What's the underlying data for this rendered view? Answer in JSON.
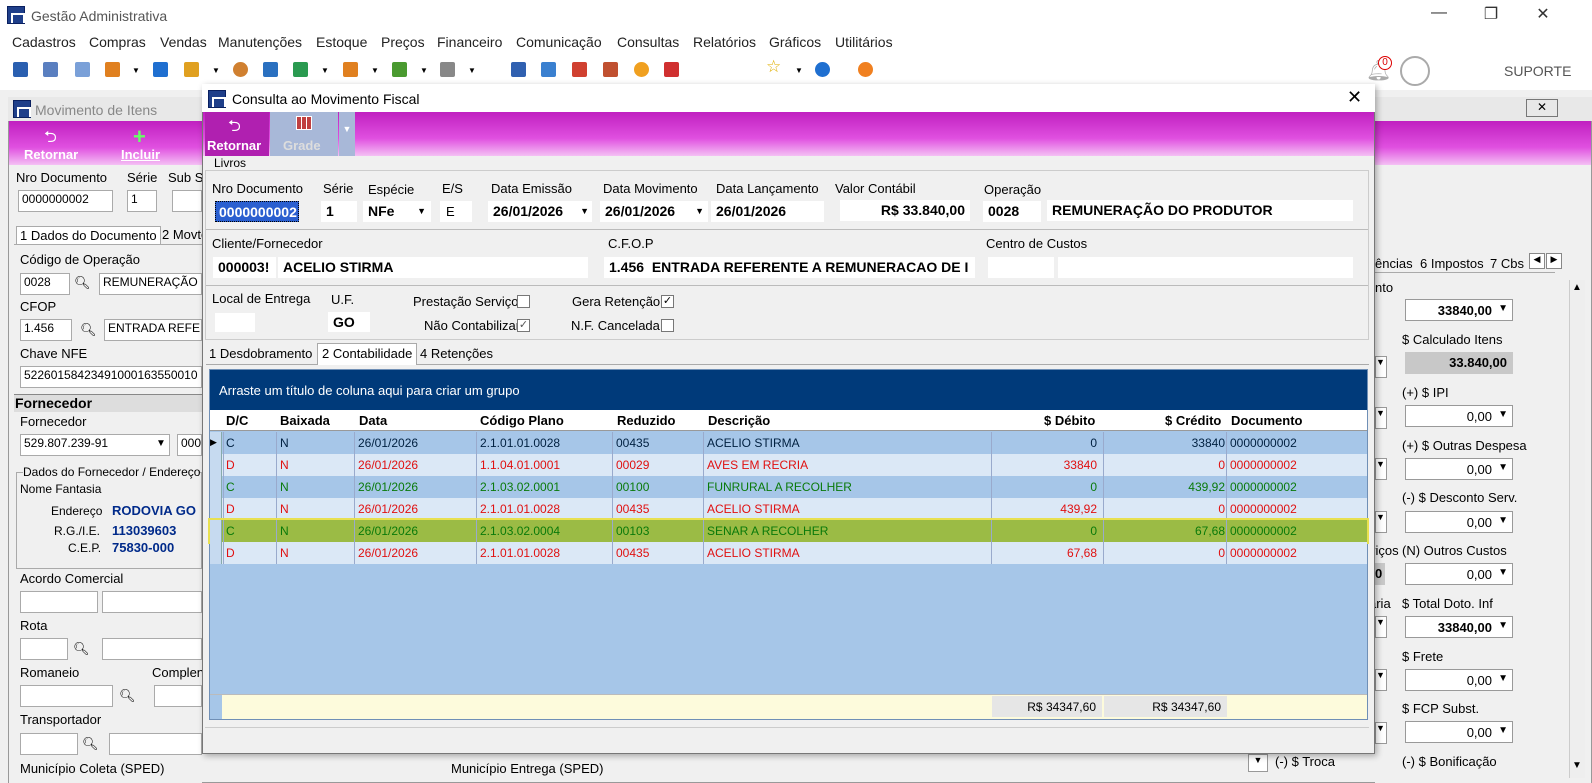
{
  "app": {
    "title": "Gestão Administrativa",
    "window_controls": {
      "minimize": "—",
      "restore": "❐",
      "close": "✕"
    }
  },
  "menu": [
    "Cadastros",
    "Compras",
    "Vendas",
    "Manutenções",
    "Estoque",
    "Preços",
    "Financeiro",
    "Comunicação",
    "Consultas",
    "Relatórios",
    "Gráficos",
    "Utilitários"
  ],
  "toolbar": {
    "notification_count": "0",
    "user_label": "SUPORTE"
  },
  "back_window": {
    "title": "Movimento de Itens",
    "actions": {
      "return": "Retornar",
      "include": "Incluir"
    },
    "labels": {
      "nro_documento": "Nro Documento",
      "serie": "Série",
      "sub_serie": "Sub S",
      "codigo_operacao": "Código de Operação",
      "cfop": "CFOP",
      "chave_nfe": "Chave NFE",
      "fornecedor_header": "Fornecedor",
      "fornecedor": "Fornecedor",
      "dados_fornecedor": "Dados do Fornecedor / Endereço",
      "nome_fantasia": "Nome Fantasia",
      "endereco": "Endereço",
      "rg_ie": "R.G./I.E.",
      "cep": "C.E.P.",
      "acordo_comercial": "Acordo Comercial",
      "rota": "Rota",
      "romaneio": "Romaneio",
      "complemento": "Complen",
      "transportador": "Transportador",
      "municipio_coleta": "Município Coleta (SPED)",
      "municipio_entrega": "Município Entrega (SPED)"
    },
    "values": {
      "nro_documento": "0000000002",
      "serie": "1",
      "codigo_operacao": "0028",
      "operacao_desc": "REMUNERAÇÃO",
      "cfop": "1.456",
      "cfop_desc": "ENTRADA REFE",
      "chave_nfe": "52260158423491000163550010",
      "fornecedor_doc": "529.807.239-91",
      "fornecedor_cod": "000",
      "endereco": "RODOVIA GO",
      "rg_ie": "113039603",
      "cep": "75830-000"
    },
    "tabs": [
      "1 Dados do Documento",
      "2 Movto"
    ],
    "right_tabs": [
      "ências",
      "6 Impostos",
      "7 Cbs"
    ],
    "right_panel": {
      "header": "nto",
      "total_top": "33840,00",
      "calc_itens_label": "$ Calculado Itens",
      "calc_itens_value": "33.840,00",
      "ipi_label": "(+) $ IPI",
      "ipi_value": "0,00",
      "outras_despesas_label": "(+) $ Outras Despesa",
      "outras_despesas_value": "0,00",
      "desconto_serv_label": "(-) $ Desconto Serv.",
      "desconto_serv_value": "0,00",
      "servicos_label": "viços",
      "outros_custos_label": "(N) Outros Custos",
      "outros_custos_value": "0,00",
      "servicos_value": "0",
      "total_doto_label": "$ Total Doto. Inf",
      "total_doto_value": "33840,00",
      "ria_label": "ária",
      "frete_label": "$ Frete",
      "frete_value": "0,00",
      "fcp_label": "$ FCP Subst.",
      "fcp_value": "0,00",
      "troca_label": "(-) $ Troca",
      "bonificacao_label": "(-) $ Bonificação"
    }
  },
  "dialog": {
    "title": "Consulta ao Movimento Fiscal",
    "actions": {
      "return": "Retornar",
      "grid": "Grade"
    },
    "section": "Livros",
    "labels": {
      "nro_documento": "Nro Documento",
      "serie": "Série",
      "especie": "Espécie",
      "es": "E/S",
      "data_emissao": "Data Emissão",
      "data_movimento": "Data Movimento",
      "data_lancamento": "Data Lançamento",
      "valor_contabil": "Valor Contábil",
      "operacao": "Operação",
      "cliente_fornecedor": "Cliente/Fornecedor",
      "cfop": "C.F.O.P",
      "centro_custos": "Centro de Custos",
      "local_entrega": "Local de Entrega",
      "uf": "U.F.",
      "prestacao_servico": "Prestação Serviço",
      "gera_retencao": "Gera Retenção",
      "nao_contabilizar": "Não Contabilizar",
      "nf_cancelada": "N.F. Cancelada"
    },
    "values": {
      "nro_documento": "0000000002",
      "serie": "1",
      "especie": "NFe",
      "es": "E",
      "data_emissao": "26/01/2026",
      "data_movimento": "26/01/2026",
      "data_lancamento": "26/01/2026",
      "valor_contabil": "R$ 33.840,00",
      "operacao_cod": "0028",
      "operacao_desc": "REMUNERAÇÃO DO PRODUTOR",
      "cliente_cod": "000003!",
      "cliente_nome": "ACELIO STIRMA",
      "cfop": "1.456",
      "cfop_desc": "ENTRADA REFERENTE A REMUNERACAO DE I",
      "uf": "GO"
    },
    "checks": {
      "prestacao_servico": false,
      "gera_retencao": true,
      "nao_contabilizar": true,
      "nf_cancelada": false
    },
    "tabs": [
      "1 Desdobramento",
      "2 Contabilidade",
      "4 Retenções"
    ],
    "active_tab": "2 Contabilidade",
    "grid": {
      "group_hint": "Arraste um título de coluna aqui para criar um grupo",
      "columns": [
        "D/C",
        "Baixada",
        "Data",
        "Código Plano",
        "Reduzido",
        "Descrição",
        "$ Débito",
        "$ Crédito",
        "Documento"
      ],
      "rows": [
        {
          "dc": "C",
          "baixada": "N",
          "data": "26/01/2026",
          "codigo": "2.1.01.01.0028",
          "reduzido": "00435",
          "descricao": "ACELIO STIRMA",
          "debito": "0",
          "credito": "33840",
          "documento": "0000000002"
        },
        {
          "dc": "D",
          "baixada": "N",
          "data": "26/01/2026",
          "codigo": "1.1.04.01.0001",
          "reduzido": "00029",
          "descricao": "AVES EM RECRIA",
          "debito": "33840",
          "credito": "0",
          "documento": "0000000002"
        },
        {
          "dc": "C",
          "baixada": "N",
          "data": "26/01/2026",
          "codigo": "2.1.03.02.0001",
          "reduzido": "00100",
          "descricao": "FUNRURAL A RECOLHER",
          "debito": "0",
          "credito": "439,92",
          "documento": "0000000002"
        },
        {
          "dc": "D",
          "baixada": "N",
          "data": "26/01/2026",
          "codigo": "2.1.01.01.0028",
          "reduzido": "00435",
          "descricao": "ACELIO STIRMA",
          "debito": "439,92",
          "credito": "0",
          "documento": "0000000002"
        },
        {
          "dc": "C",
          "baixada": "N",
          "data": "26/01/2026",
          "codigo": "2.1.03.02.0004",
          "reduzido": "00103",
          "descricao": "SENAR A RECOLHER",
          "debito": "0",
          "credito": "67,68",
          "documento": "0000000002"
        },
        {
          "dc": "D",
          "baixada": "N",
          "data": "26/01/2026",
          "codigo": "2.1.01.01.0028",
          "reduzido": "00435",
          "descricao": "ACELIO STIRMA",
          "debito": "67,68",
          "credito": "0",
          "documento": "0000000002"
        }
      ],
      "total_debito": "R$ 34347,60",
      "total_credito": "R$ 34347,60"
    },
    "close": "✕"
  },
  "colors": {
    "credit": "#0a7a0a",
    "debit": "#e01010",
    "magenta": "#c020c0",
    "grid_bg": "#a6c6e8",
    "group_bar": "#003a7a",
    "highlight": "#9bbb45"
  }
}
